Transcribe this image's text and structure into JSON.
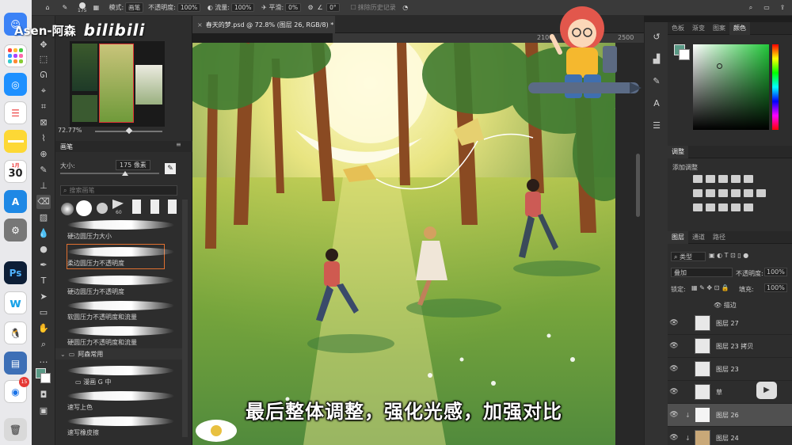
{
  "watermark": {
    "channel": "Asen-阿森",
    "logo": "bilibili"
  },
  "options_bar": {
    "brush_size_small": "175",
    "mode_label": "模式:",
    "mode_value": "画笔",
    "opacity_label": "不透明度:",
    "opacity_value": "100%",
    "flow_label": "流量:",
    "flow_value": "100%",
    "smoothing_label": "平滑:",
    "smoothing_value": "0%",
    "angle_value": "0°",
    "history_label": "抹除历史记录"
  },
  "doc_tab": {
    "title": "春天的梦.psd @ 72.8% (图层 26, RGB/8) *"
  },
  "ruler": {
    "mark_2100": "2100",
    "mark_2500": "2500"
  },
  "navigator": {
    "zoom": "72.77%"
  },
  "brush_panel": {
    "tab": "画笔",
    "size_label": "大小:",
    "size_value": "175 像素",
    "search_placeholder": "搜索画笔",
    "preset_size": "60",
    "brushes": [
      {
        "label": "硬边圆压力大小"
      },
      {
        "label": "柔边圆压力不透明度",
        "selected": true
      },
      {
        "label": "硬边圆压力不透明度"
      },
      {
        "label": "软圆压力不透明度和流量"
      },
      {
        "label": "硬圆压力不透明度和流量"
      }
    ],
    "group_label": "阿森常用",
    "group_brushes": [
      {
        "label": "漫画 G 中"
      },
      {
        "label": "速写上色"
      },
      {
        "label": "速写橡皮擦"
      }
    ]
  },
  "color_panel": {
    "tabs": [
      "色板",
      "渐变",
      "图案",
      "颜色"
    ],
    "active_tab": "颜色",
    "foreground": "#5a9a86",
    "field_color": "#22c83a"
  },
  "adjust_panel": {
    "title": "调整",
    "add_label": "添加调整"
  },
  "layers_panel": {
    "tabs": [
      "图层",
      "通道",
      "路径"
    ],
    "active_tab": "图层",
    "filter_label": "类型",
    "blend_mode": "叠加",
    "opacity_label": "不透明度:",
    "opacity_value": "100%",
    "lock_label": "锁定:",
    "fill_label": "填充:",
    "fill_value": "100%",
    "sub_label": "描边",
    "layers": [
      {
        "name": "图层 27"
      },
      {
        "name": "图层 23 拷贝"
      },
      {
        "name": "图层 23"
      },
      {
        "name": "草"
      },
      {
        "name": "图层 26",
        "selected": true
      },
      {
        "name": "图层 24"
      }
    ]
  },
  "dock": {
    "calendar_month": "1月",
    "calendar_day": "30",
    "ps_label": "Ps",
    "notif_badge": "15"
  },
  "subtitle": "最后整体调整，强化光感，加强对比"
}
